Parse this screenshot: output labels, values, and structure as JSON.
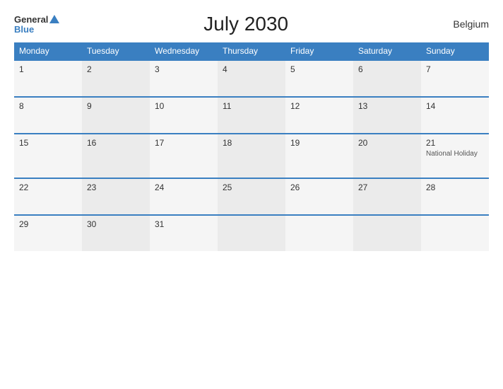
{
  "header": {
    "logo_general": "General",
    "logo_blue": "Blue",
    "title": "July 2030",
    "country": "Belgium"
  },
  "weekdays": [
    "Monday",
    "Tuesday",
    "Wednesday",
    "Thursday",
    "Friday",
    "Saturday",
    "Sunday"
  ],
  "weeks": [
    [
      {
        "day": "1",
        "holiday": ""
      },
      {
        "day": "2",
        "holiday": ""
      },
      {
        "day": "3",
        "holiday": ""
      },
      {
        "day": "4",
        "holiday": ""
      },
      {
        "day": "5",
        "holiday": ""
      },
      {
        "day": "6",
        "holiday": ""
      },
      {
        "day": "7",
        "holiday": ""
      }
    ],
    [
      {
        "day": "8",
        "holiday": ""
      },
      {
        "day": "9",
        "holiday": ""
      },
      {
        "day": "10",
        "holiday": ""
      },
      {
        "day": "11",
        "holiday": ""
      },
      {
        "day": "12",
        "holiday": ""
      },
      {
        "day": "13",
        "holiday": ""
      },
      {
        "day": "14",
        "holiday": ""
      }
    ],
    [
      {
        "day": "15",
        "holiday": ""
      },
      {
        "day": "16",
        "holiday": ""
      },
      {
        "day": "17",
        "holiday": ""
      },
      {
        "day": "18",
        "holiday": ""
      },
      {
        "day": "19",
        "holiday": ""
      },
      {
        "day": "20",
        "holiday": ""
      },
      {
        "day": "21",
        "holiday": "National Holiday"
      }
    ],
    [
      {
        "day": "22",
        "holiday": ""
      },
      {
        "day": "23",
        "holiday": ""
      },
      {
        "day": "24",
        "holiday": ""
      },
      {
        "day": "25",
        "holiday": ""
      },
      {
        "day": "26",
        "holiday": ""
      },
      {
        "day": "27",
        "holiday": ""
      },
      {
        "day": "28",
        "holiday": ""
      }
    ],
    [
      {
        "day": "29",
        "holiday": ""
      },
      {
        "day": "30",
        "holiday": ""
      },
      {
        "day": "31",
        "holiday": ""
      },
      {
        "day": "",
        "holiday": ""
      },
      {
        "day": "",
        "holiday": ""
      },
      {
        "day": "",
        "holiday": ""
      },
      {
        "day": "",
        "holiday": ""
      }
    ]
  ]
}
